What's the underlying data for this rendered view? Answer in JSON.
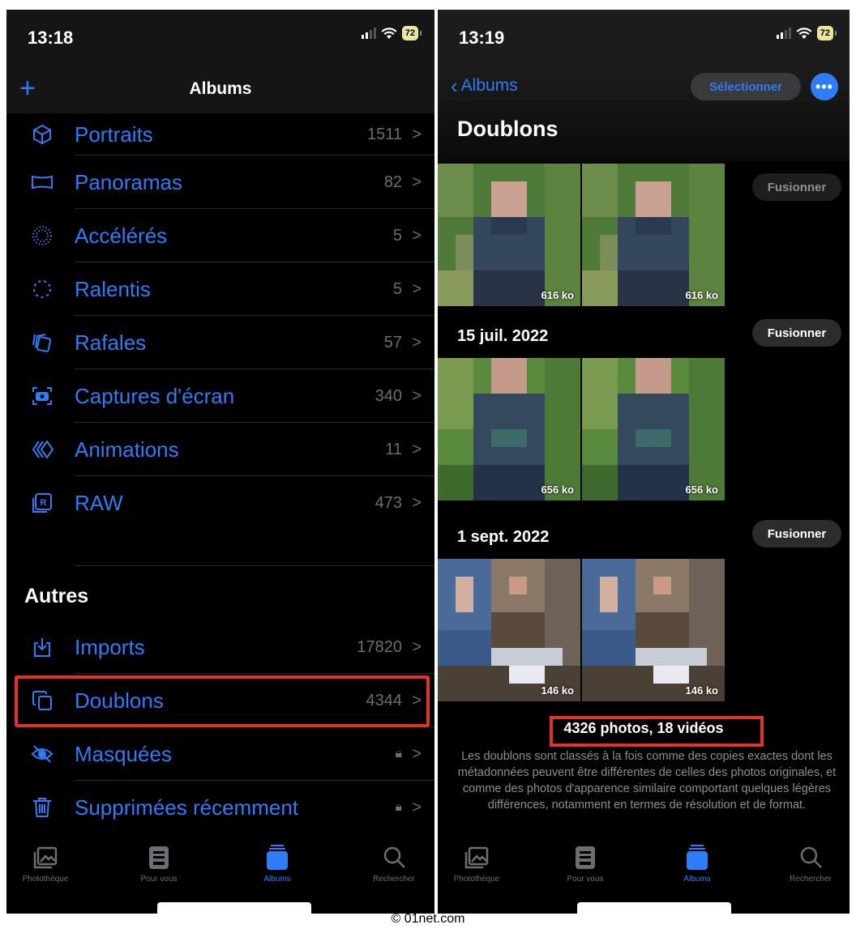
{
  "left": {
    "status": {
      "time": "13:18",
      "battery": "72"
    },
    "nav": {
      "add_icon": "plus-icon",
      "title": "Albums"
    },
    "media_types": [
      {
        "label": "Portraits",
        "count": "1511",
        "icon": "cube-icon"
      },
      {
        "label": "Panoramas",
        "count": "82",
        "icon": "panorama-icon"
      },
      {
        "label": "Accélérés",
        "count": "5",
        "icon": "timelapse-icon"
      },
      {
        "label": "Ralentis",
        "count": "5",
        "icon": "slowmo-icon"
      },
      {
        "label": "Rafales",
        "count": "57",
        "icon": "burst-icon"
      },
      {
        "label": "Captures d'écran",
        "count": "340",
        "icon": "screenshot-icon"
      },
      {
        "label": "Animations",
        "count": "11",
        "icon": "animation-icon"
      },
      {
        "label": "RAW",
        "count": "473",
        "icon": "raw-icon"
      }
    ],
    "others_title": "Autres",
    "others": [
      {
        "label": "Imports",
        "count": "17820",
        "icon": "import-icon"
      },
      {
        "label": "Doublons",
        "count": "4344",
        "icon": "duplicate-icon"
      },
      {
        "label": "Masquées",
        "count": "",
        "icon": "hidden-icon"
      },
      {
        "label": "Supprimées récemment",
        "count": "",
        "icon": "trash-icon"
      }
    ]
  },
  "right": {
    "status": {
      "time": "13:19",
      "battery": "72"
    },
    "nav": {
      "back_label": "Albums",
      "select_label": "Sélectionner",
      "more_label": "•••"
    },
    "title": "Doublons",
    "groups": [
      {
        "date": "",
        "merge_label": "Fusionner",
        "sizes": [
          "616 ko",
          "616 ko"
        ]
      },
      {
        "date": "15 juil. 2022",
        "merge_label": "Fusionner",
        "sizes": [
          "656 ko",
          "656 ko"
        ]
      },
      {
        "date": "1 sept. 2022",
        "merge_label": "Fusionner",
        "sizes": [
          "146 ko",
          "146 ko"
        ]
      }
    ],
    "summary": "4326 photos, 18 vidéos",
    "description": "Les doublons sont classés à la fois comme des copies exactes dont les métadonnées peuvent être différentes de celles des photos originales, et comme des photos d'apparence similaire comportant quelques légères différences, notamment en termes de résolution et de format."
  },
  "tabs": [
    {
      "label": "Photothèque",
      "icon": "photo-library-icon"
    },
    {
      "label": "Pour vous",
      "icon": "for-you-icon"
    },
    {
      "label": "Albums",
      "icon": "albums-icon"
    },
    {
      "label": "Rechercher",
      "icon": "search-icon"
    }
  ],
  "credit": "© 01net.com",
  "colors": {
    "accent": "#2f7cf6",
    "highlight": "#e0332a",
    "background": "#000000"
  }
}
